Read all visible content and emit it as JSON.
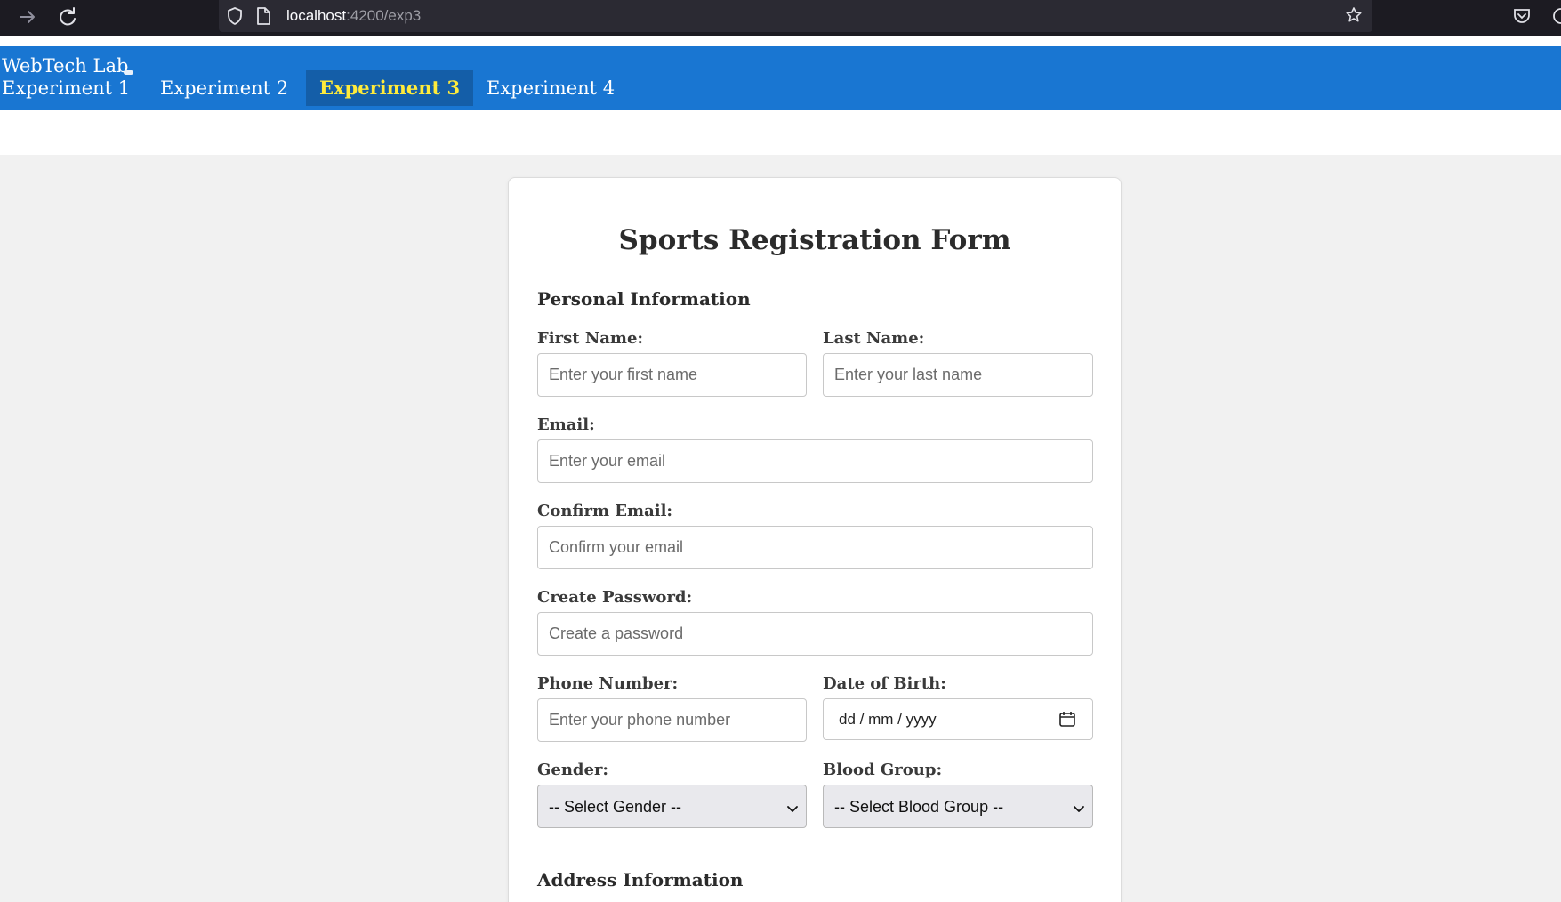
{
  "browser": {
    "url_host": "localhost",
    "url_path": ":4200/exp3",
    "icons": [
      "forward-arrow-icon",
      "reload-icon",
      "shield-icon",
      "page-icon",
      "star-icon",
      "pocket-icon"
    ]
  },
  "nav": {
    "brand": "WebTech Lab",
    "links": [
      "Experiment 1",
      "Experiment 2",
      "Experiment 3",
      "Experiment 4"
    ],
    "active_index": 2,
    "colors": {
      "bar": "#1976d2",
      "active_bg": "#145ea8",
      "active_text": "#ffeb3b"
    }
  },
  "form": {
    "title": "Sports Registration Form",
    "sections": {
      "personal": "Personal Information",
      "address": "Address Information"
    },
    "fields": {
      "first_name": {
        "label": "First Name:",
        "placeholder": "Enter your first name"
      },
      "last_name": {
        "label": "Last Name:",
        "placeholder": "Enter your last name"
      },
      "email": {
        "label": "Email:",
        "placeholder": "Enter your email"
      },
      "confirm_email": {
        "label": "Confirm Email:",
        "placeholder": "Confirm your email"
      },
      "password": {
        "label": "Create Password:",
        "placeholder": "Create a password"
      },
      "phone": {
        "label": "Phone Number:",
        "placeholder": "Enter your phone number"
      },
      "dob": {
        "label": "Date of Birth:",
        "value": "dd / mm / yyyy"
      },
      "gender": {
        "label": "Gender:",
        "selected": "-- Select Gender --"
      },
      "blood_group": {
        "label": "Blood Group:",
        "selected": "-- Select Blood Group --"
      }
    }
  }
}
